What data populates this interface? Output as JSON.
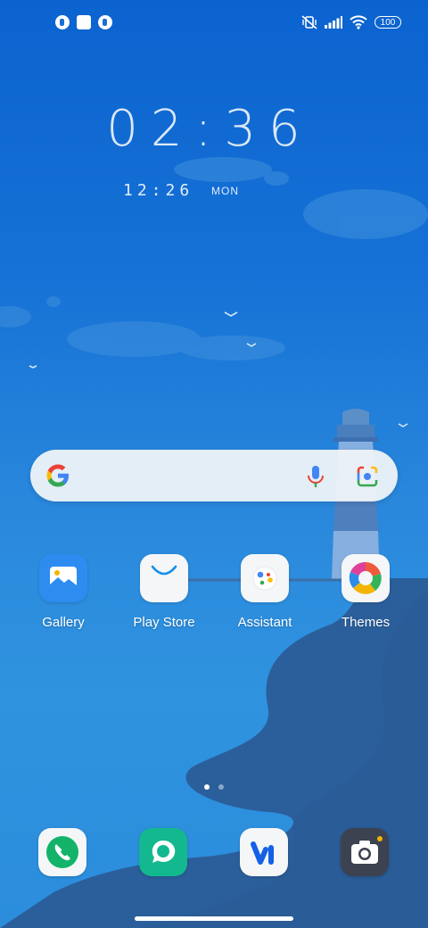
{
  "status_bar": {
    "battery_level": "100",
    "notification_icons": [
      "app-notification-icon",
      "stop-square-icon",
      "app-notification-icon"
    ],
    "system_icons": [
      "vibrate-off-icon",
      "signal-icon",
      "wifi-icon",
      "battery-icon"
    ]
  },
  "clock": {
    "main_time": "02:36",
    "secondary_time": "12:26",
    "secondary_day": "MON"
  },
  "search": {
    "icons": [
      "google-g-icon",
      "microphone-icon",
      "google-lens-icon"
    ]
  },
  "apps": [
    {
      "label": "Gallery",
      "icon": "gallery-icon"
    },
    {
      "label": "Play Store",
      "icon": "play-store-icon"
    },
    {
      "label": "Assistant",
      "icon": "assistant-icon"
    },
    {
      "label": "Themes",
      "icon": "themes-icon"
    }
  ],
  "page_indicator": {
    "pages": 2,
    "current": 1
  },
  "dock": [
    {
      "icon": "phone-icon"
    },
    {
      "icon": "messages-icon"
    },
    {
      "icon": "vi-app-icon"
    },
    {
      "icon": "camera-icon"
    }
  ],
  "colors": {
    "sky_top": "#0b63cf",
    "sea": "#2f93df",
    "cliff": "#2a5e98",
    "accent_green": "#13b36a"
  }
}
